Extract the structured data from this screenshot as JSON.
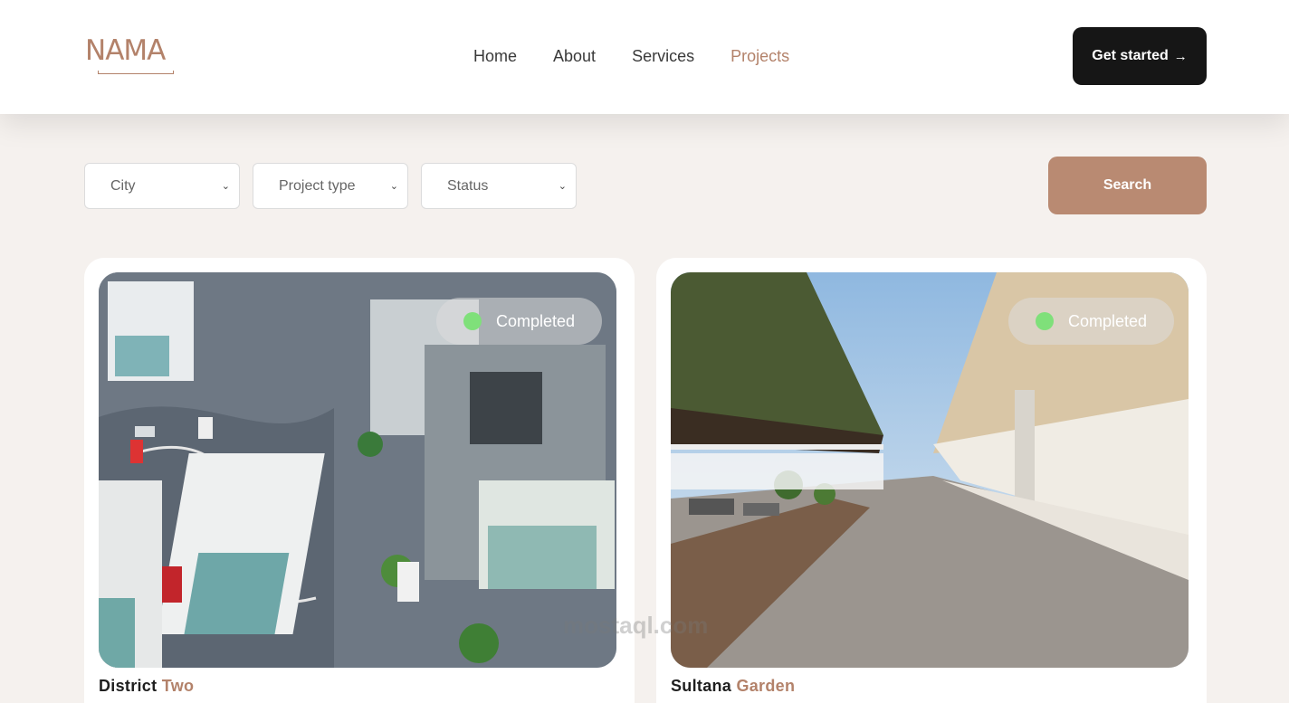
{
  "brand": {
    "logo_text": "NAMA"
  },
  "nav": {
    "items": [
      {
        "label": "Home",
        "active": false
      },
      {
        "label": "About",
        "active": false
      },
      {
        "label": "Services",
        "active": false
      },
      {
        "label": "Projects",
        "active": true
      }
    ]
  },
  "header": {
    "cta_label": "Get started",
    "cta_icon": "arrow-right-icon"
  },
  "filters": {
    "city": {
      "value": "City"
    },
    "project_type": {
      "value": "Project type"
    },
    "status": {
      "value": "Status"
    },
    "search_label": "Search"
  },
  "projects": [
    {
      "title_main": "District",
      "title_accent": "Two",
      "status": "Completed"
    },
    {
      "title_main": "Sultana",
      "title_accent": "Garden",
      "status": "Completed"
    }
  ],
  "watermark": "mostaql.com",
  "colors": {
    "accent": "#b3826a",
    "search_button": "#b98a72",
    "cta": "#161616",
    "status_dot": "#7fe07a"
  }
}
